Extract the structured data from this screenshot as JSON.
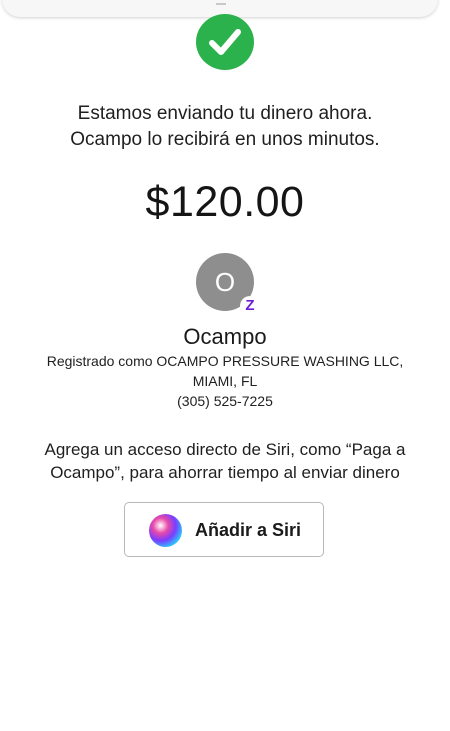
{
  "status": {
    "line1": "Estamos enviando tu dinero ahora.",
    "line2": "Ocampo lo recibirá en unos minutos."
  },
  "payment": {
    "amount": "$120.00"
  },
  "recipient": {
    "initial": "O",
    "service_glyph": "Z",
    "name": "Ocampo",
    "registered_line1": "Registrado como OCAMPO PRESSURE WASHING LLC,",
    "registered_line2": "MIAMI, FL",
    "phone": "(305) 525-7225"
  },
  "siri": {
    "hint_line1": "Agrega un acceso directo de Siri, como “Paga a",
    "hint_line2": "Ocampo”, para ahorrar tiempo al enviar dinero",
    "button_label": "Añadir a Siri"
  },
  "colors": {
    "success": "#2bb24c",
    "avatar": "#8e8e8e",
    "zelle": "#6d1ed4"
  }
}
